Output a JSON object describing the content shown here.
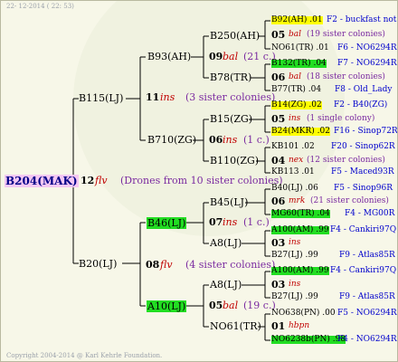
{
  "header": {
    "date": "22- 12-2014 ( 22: 53)"
  },
  "footer": {
    "copyright": "Copyright 2004-2014 @ Karl Kehrle Foundation."
  },
  "root": {
    "name": "B204(MAK)",
    "num": "12",
    "tag": "flv",
    "note": "(Drones from 10 sister colonies)"
  },
  "level1": {
    "upper": {
      "name": "B115(LJ)",
      "num": "11",
      "tag": "ins",
      "note": "(3 sister colonies)"
    },
    "lower": {
      "name": "B20(LJ)",
      "num": "08",
      "tag": "flv",
      "note": "(4 sister colonies)"
    }
  },
  "level2": {
    "a": {
      "name": "B93(AH)",
      "num": "09",
      "tag": "bal",
      "note": "(21 c.)"
    },
    "b": {
      "name": "B710(ZG)",
      "num": "06",
      "tag": "ins",
      "note": "(1 c.)"
    },
    "c": {
      "name": "B46(LJ)",
      "num": "07",
      "tag": "ins",
      "note": "(1 c.)"
    },
    "d": {
      "name": "A10(LJ)",
      "num": "05",
      "tag": "bal",
      "note": "(19 c.)"
    }
  },
  "level3": {
    "a1": "B250(AH)",
    "a2": "B78(TR)",
    "b1": "B15(ZG)",
    "b2": "B110(ZG)",
    "c1": "B45(LJ)",
    "c2": "A8(LJ)",
    "d1": "A8(LJ)",
    "d2": "NO61(TR)"
  },
  "leaves": [
    {
      "top": "B92(AH) .01",
      "top_code": "F2 - buckfast not",
      "mid_num": "05",
      "mid_tag": "bal",
      "mid_note": "(19 sister colonies)",
      "bot": "NO61(TR) .01",
      "bot_code": "F6 - NO6294R"
    },
    {
      "top": "B132(TR) .04",
      "top_code": "F7 - NO6294R",
      "mid_num": "06",
      "mid_tag": "bal",
      "mid_note": "(18 sister colonies)",
      "bot": "B77(TR) .04",
      "bot_code": "F8 - Old_Lady"
    },
    {
      "top": "B14(ZG) .02",
      "top_code": "F2 - B40(ZG)",
      "mid_num": "05",
      "mid_tag": "ins",
      "mid_note": "(1 single colony)",
      "bot": "B24(MKR) .02",
      "bot_code": "F16 - Sinop72R"
    },
    {
      "top": "KB101 .02",
      "top_code": "F20 - Sinop62R",
      "mid_num": "04",
      "mid_tag": "nex",
      "mid_note": "(12 sister colonies)",
      "bot": "KB113 .01",
      "bot_code": "F5 - Maced93R"
    },
    {
      "top": "B40(LJ) .06",
      "top_code": "F5 - Sinop96R",
      "mid_num": "06",
      "mid_tag": "mrk",
      "mid_note": "(21 sister colonies)",
      "bot": "MG60(TR) .04",
      "bot_code": "F4 - MG00R"
    },
    {
      "top": "A100(AM) .99",
      "top_code": "F4 - Cankiri97Q",
      "mid_num": "03",
      "mid_tag": "ins",
      "mid_note": "",
      "bot": "B27(LJ) .99",
      "bot_code": "F9 - Atlas85R"
    },
    {
      "top": "A100(AM) .99",
      "top_code": "F4 - Cankiri97Q",
      "mid_num": "03",
      "mid_tag": "ins",
      "mid_note": "",
      "bot": "B27(LJ) .99",
      "bot_code": "F9 - Atlas85R"
    },
    {
      "top": "NO638(PN) .00",
      "top_code": "F5 - NO6294R",
      "mid_num": "01",
      "mid_tag": "hbpn",
      "mid_note": "",
      "bot": "NO6238b(PN) .98",
      "bot_code": "F4 - NO6294R"
    }
  ]
}
